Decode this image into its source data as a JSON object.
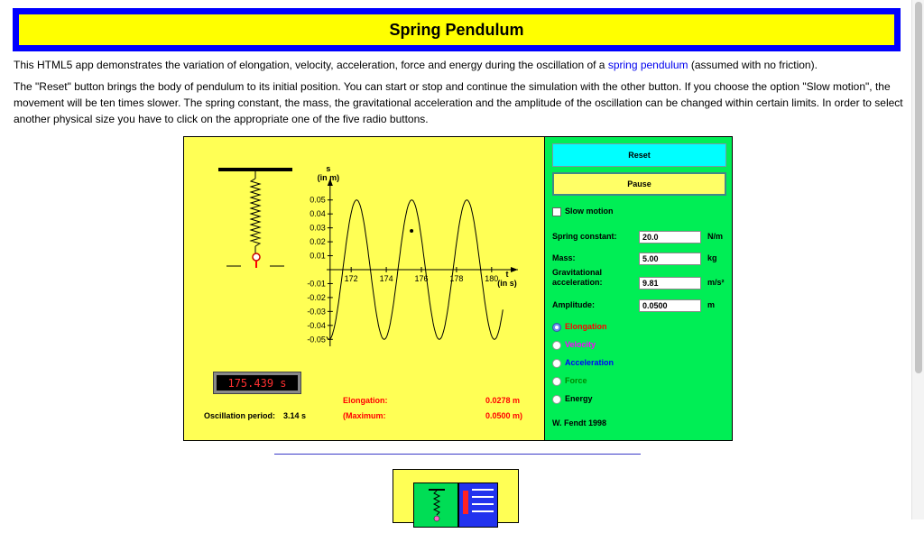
{
  "page": {
    "title": "Spring Pendulum",
    "para1_before": "This HTML5 app demonstrates the variation of elongation, velocity, acceleration, force and energy during the oscillation of a ",
    "para1_link": "spring pendulum",
    "para1_after": " (assumed with no friction).",
    "para2": "The \"Reset\" button brings the body of pendulum to its initial position. You can start or stop and continue the simulation with the other button. If you choose the option \"Slow motion\", the movement will be ten times slower. The spring constant, the mass, the gravitational acceleration and the amplitude of the oscillation can be changed within certain limits. In order to select another physical size you have to click on the appropriate one of the five radio buttons."
  },
  "controls": {
    "reset_label": "Reset",
    "pause_label": "Pause",
    "slow_motion_label": "Slow motion",
    "slow_motion_checked": false,
    "spring_constant": {
      "label": "Spring constant:",
      "value": "20.0",
      "unit": "N/m"
    },
    "mass": {
      "label": "Mass:",
      "value": "5.00",
      "unit": "kg"
    },
    "gravity": {
      "label_line1": "Gravitational",
      "label_line2": "acceleration:",
      "value": "9.81",
      "unit": "m/s²"
    },
    "amplitude": {
      "label": "Amplitude:",
      "value": "0.0500",
      "unit": "m"
    },
    "radios": [
      {
        "label": "Elongation",
        "color": "#ff0000",
        "selected": true
      },
      {
        "label": "Velocity",
        "color": "#ff00ff",
        "selected": false
      },
      {
        "label": "Acceleration",
        "color": "#0000ff",
        "selected": false
      },
      {
        "label": "Force",
        "color": "#008800",
        "selected": false
      },
      {
        "label": "Energy",
        "color": "#000000",
        "selected": false
      }
    ],
    "author": "W. Fendt 1998"
  },
  "simulation": {
    "timer": "175.439 s",
    "period_label": "Oscillation period:",
    "period_value": "3.14 s",
    "elongation_label": "Elongation:",
    "elongation_value": "0.0278 m",
    "maximum_label": "(Maximum:",
    "maximum_value": "0.0500 m)"
  },
  "chart_data": {
    "type": "line",
    "ylabel_line1": "s",
    "ylabel_line2": "(in m)",
    "xlabel_line1": "t",
    "xlabel_line2": "(in s)",
    "x_ticks": [
      "172",
      "174",
      "176",
      "178",
      "180"
    ],
    "y_ticks": [
      "0.05",
      "0.04",
      "0.03",
      "0.02",
      "0.01",
      "-0.01",
      "-0.02",
      "-0.03",
      "-0.04",
      "-0.05"
    ],
    "xlim": [
      170.5,
      181.5
    ],
    "ylim": [
      -0.055,
      0.055
    ],
    "series": [
      {
        "amplitude": 0.05,
        "period": 3.14,
        "phase_time": 172.31,
        "t_start": 170.6,
        "t_end": 180.65,
        "color": "#000000"
      }
    ],
    "current_point": {
      "t": 175.44,
      "s": 0.0278
    }
  }
}
